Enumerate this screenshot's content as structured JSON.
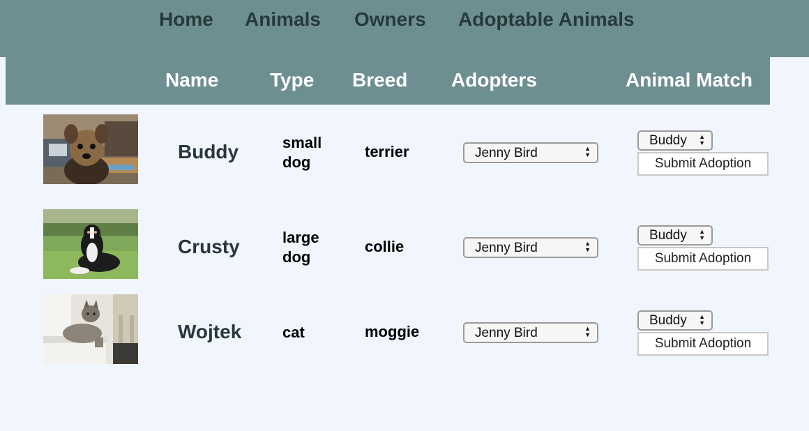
{
  "nav": {
    "items": [
      {
        "label": "Home"
      },
      {
        "label": "Animals"
      },
      {
        "label": "Owners"
      },
      {
        "label": "Adoptable Animals"
      }
    ]
  },
  "table": {
    "headers": [
      "Name",
      "Type",
      "Breed",
      "Adopters",
      "Animal Match"
    ],
    "rows": [
      {
        "name": "Buddy",
        "type": "small dog",
        "breed": "terrier",
        "adopter": "Jenny Bird",
        "match": "Buddy",
        "submit": "Submit Adoption",
        "photo": "yorkshire-terrier-photo"
      },
      {
        "name": "Crusty",
        "type": "large dog",
        "breed": "collie",
        "adopter": "Jenny Bird",
        "match": "Buddy",
        "submit": "Submit Adoption",
        "photo": "border-collie-photo"
      },
      {
        "name": "Wojtek",
        "type": "cat",
        "breed": "moggie",
        "adopter": "Jenny Bird",
        "match": "Buddy",
        "submit": "Submit Adoption",
        "photo": "tabby-cat-photo"
      }
    ]
  },
  "colors": {
    "nav_bg": "#6e8f92",
    "nav_text": "#27393b",
    "page_bg": "#f1f5fd",
    "header_text": "#ffffff"
  }
}
